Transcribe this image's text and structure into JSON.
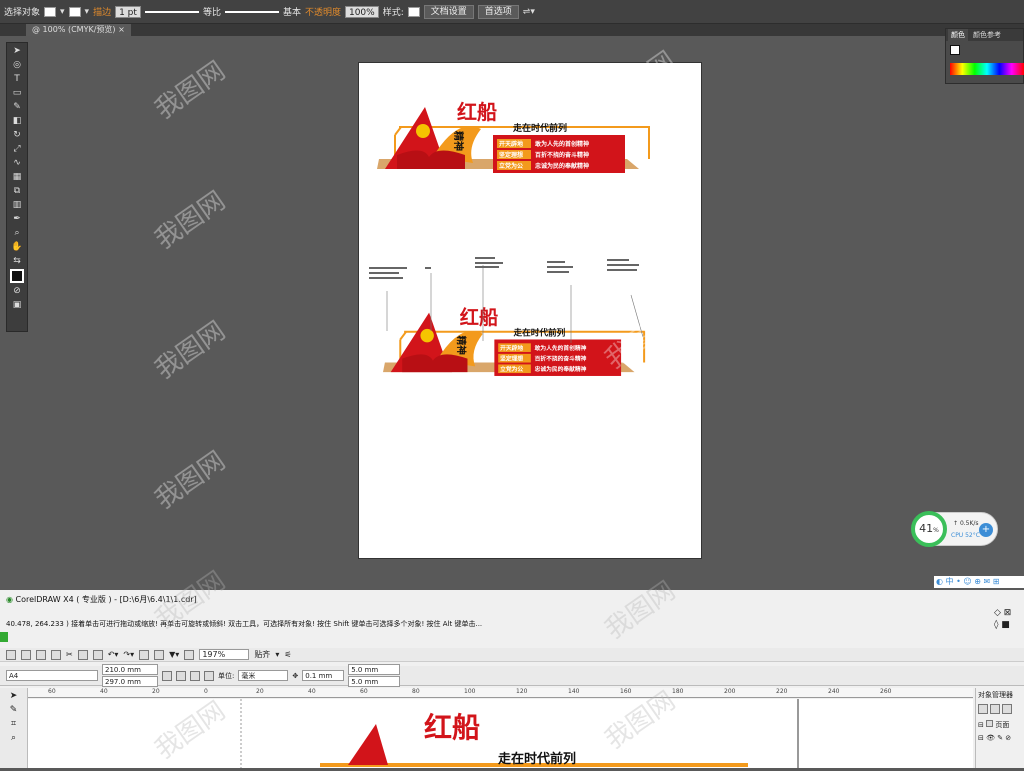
{
  "ai_control_bar": {
    "select_label": "选择对象",
    "stroke_label": "描边",
    "stroke_weight": "1 pt",
    "profile_uniform": "等比",
    "brush": "基本",
    "opacity_label": "不透明度",
    "opacity_value": "100%",
    "style_label": "样式:",
    "doc_setup": "文档设置",
    "prefs": "首选项"
  },
  "ai_tab": {
    "title": "@ 100% (CMYK/预览)",
    "close": "×"
  },
  "ai_color_panel": {
    "tab_color": "颜色",
    "tab_guide": "颜色参考"
  },
  "design": {
    "title_big": "红船",
    "title_small": "精神",
    "slogan": "走在时代前列",
    "rows": [
      {
        "tag": "开天辟地",
        "text": "敢为人先的首创精神"
      },
      {
        "tag": "坚定理想",
        "text": "百折不挠的奋斗精神"
      },
      {
        "tag": "立党为公",
        "text": "忠诚为民的奉献精神"
      }
    ],
    "colors": {
      "red": "#d2141a",
      "orange": "#f39a1c",
      "tan": "#d9a66a"
    }
  },
  "widget": {
    "percent": "41",
    "unit": "%",
    "speed": "0.5K/s",
    "cpu": "CPU 52°C",
    "plus": "+"
  },
  "corel": {
    "title": "CorelDRAW X4 ( 专业版 ) - [D:\\6月\\6.4\\1\\1.cdr]",
    "status": "40.478, 264.233 )      接着单击可进行拖动或缩放! 再单击可旋转或倾斜! 双击工具，可选择所有对象! 按住 Shift 键单击可选择多个对象! 按住 Alt 键单击...",
    "zoom": "197%",
    "snap": "贴齐",
    "page_size": "A4",
    "width": "210.0 mm",
    "height": "297.0 mm",
    "unit_label": "单位:",
    "unit": "毫米",
    "nudge": "0.1 mm",
    "dup_x": "5.0 mm",
    "dup_y": "5.0 mm",
    "obj_mgr": "对象管理器",
    "page_label": "页面",
    "ruler": [
      "60",
      "40",
      "20",
      "0",
      "20",
      "40",
      "60",
      "80",
      "100",
      "120",
      "140",
      "160",
      "180",
      "200",
      "220",
      "240",
      "260"
    ]
  },
  "watermark": "我图网"
}
